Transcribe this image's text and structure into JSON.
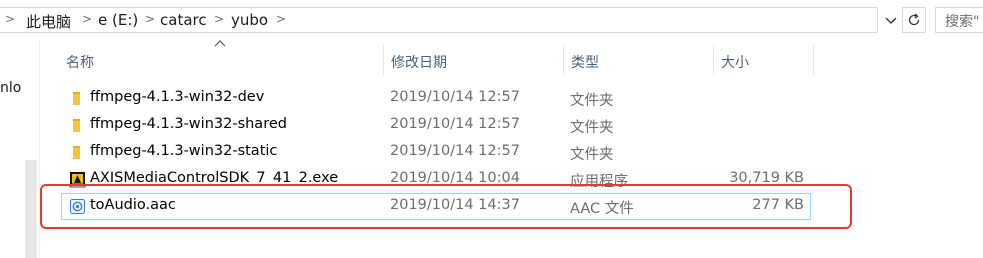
{
  "address": {
    "segments": [
      "此电脑",
      "e (E:)",
      "catarc",
      "yubo"
    ]
  },
  "search": {
    "placeholder": "搜索\""
  },
  "nav": {
    "partial_label": "nlo"
  },
  "columns": {
    "name": "名称",
    "date": "修改日期",
    "type": "类型",
    "size": "大小"
  },
  "files": [
    {
      "name": "ffmpeg-4.1.3-win32-dev",
      "date": "2019/10/14 12:57",
      "type": "文件夹",
      "size": "",
      "icon": "folder-icon"
    },
    {
      "name": "ffmpeg-4.1.3-win32-shared",
      "date": "2019/10/14 12:57",
      "type": "文件夹",
      "size": "",
      "icon": "folder-icon"
    },
    {
      "name": "ffmpeg-4.1.3-win32-static",
      "date": "2019/10/14 12:57",
      "type": "文件夹",
      "size": "",
      "icon": "folder-icon"
    },
    {
      "name": "AXISMediaControlSDK_7_41_2.exe",
      "date": "2019/10/14 10:04",
      "type": "应用程序",
      "size": "30,719 KB",
      "icon": "exe-icon"
    },
    {
      "name": "toAudio.aac",
      "date": "2019/10/14 14:37",
      "type": "AAC 文件",
      "size": "277 KB",
      "icon": "audio-file-icon"
    }
  ],
  "colors": {
    "highlight": "#e53935",
    "header_text": "#4c607a",
    "folder": "#f5c342"
  }
}
